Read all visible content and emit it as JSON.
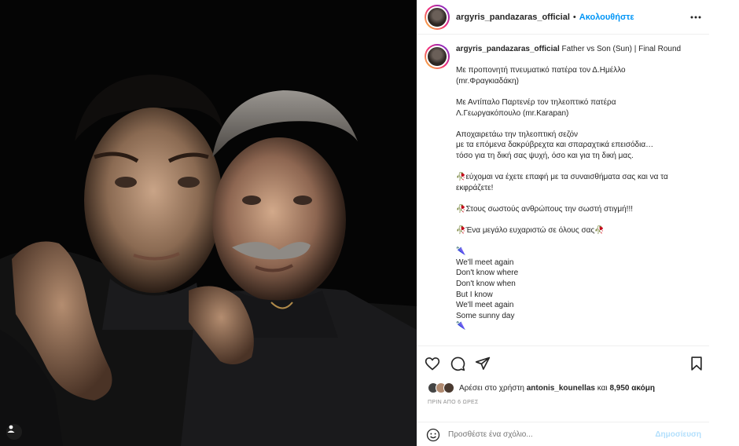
{
  "post": {
    "username": "argyris_pandazaras_official",
    "follow_label": "Ακολουθήστε",
    "separator": "•",
    "caption_title": "Father vs Son (Sun) | Final Round",
    "caption_lines": [
      "Με προπονητή πνευματικό πατέρα τον Δ.Ημέλλο",
      "(mr.Φραγκιαδάκη)",
      "",
      "Με Αντίπαλο Παρτενέρ τον τηλεοπτικό πατέρα",
      "Λ.Γεωργακόπουλο (mr.Karapan)",
      "",
      "Αποχαιρετάω την τηλεοπτική σεζόν",
      "με τα επόμενα δακρύβρεχτα και σπαραχτικά επεισόδια…",
      "τόσο για τη δική σας ψυχή, όσο και για τη δική μας.",
      "",
      "🥀εύχομαι να έχετε επαφή με τα συναισθήματα σας και να τα",
      "εκφράζετε!",
      "",
      "🥀Στους σωστούς ανθρώπους την σωστή στιγμή!!!",
      "",
      "🥀Ένα μεγάλο ευχαριστώ σε όλους σας🥀",
      "",
      "🌂",
      "We'll meet again",
      "Don't know where",
      "Don't know when",
      "But I know",
      "We'll meet again",
      "Some sunny day",
      "🌂"
    ]
  },
  "likes": {
    "prefix": "Αρέσει στο χρήστη",
    "user": "antonis_kounellas",
    "connector": "και",
    "count": "8,950 ακόμη"
  },
  "timestamp": "ΠΡΙΝ ΑΠΟ 6 ΩΡΕΣ",
  "comment": {
    "placeholder": "Προσθέστε ένα σχόλιο...",
    "post_label": "Δημοσίευση"
  },
  "icons": {
    "like": "heart-icon",
    "comment": "comment-icon",
    "share": "share-icon",
    "save": "bookmark-icon",
    "emoji": "emoji-icon",
    "more": "more-icon",
    "tag": "user-tag-icon"
  },
  "colors": {
    "link_blue": "#0095f6",
    "muted": "#8e8e8e",
    "disabled_blue": "#b2dffc"
  }
}
